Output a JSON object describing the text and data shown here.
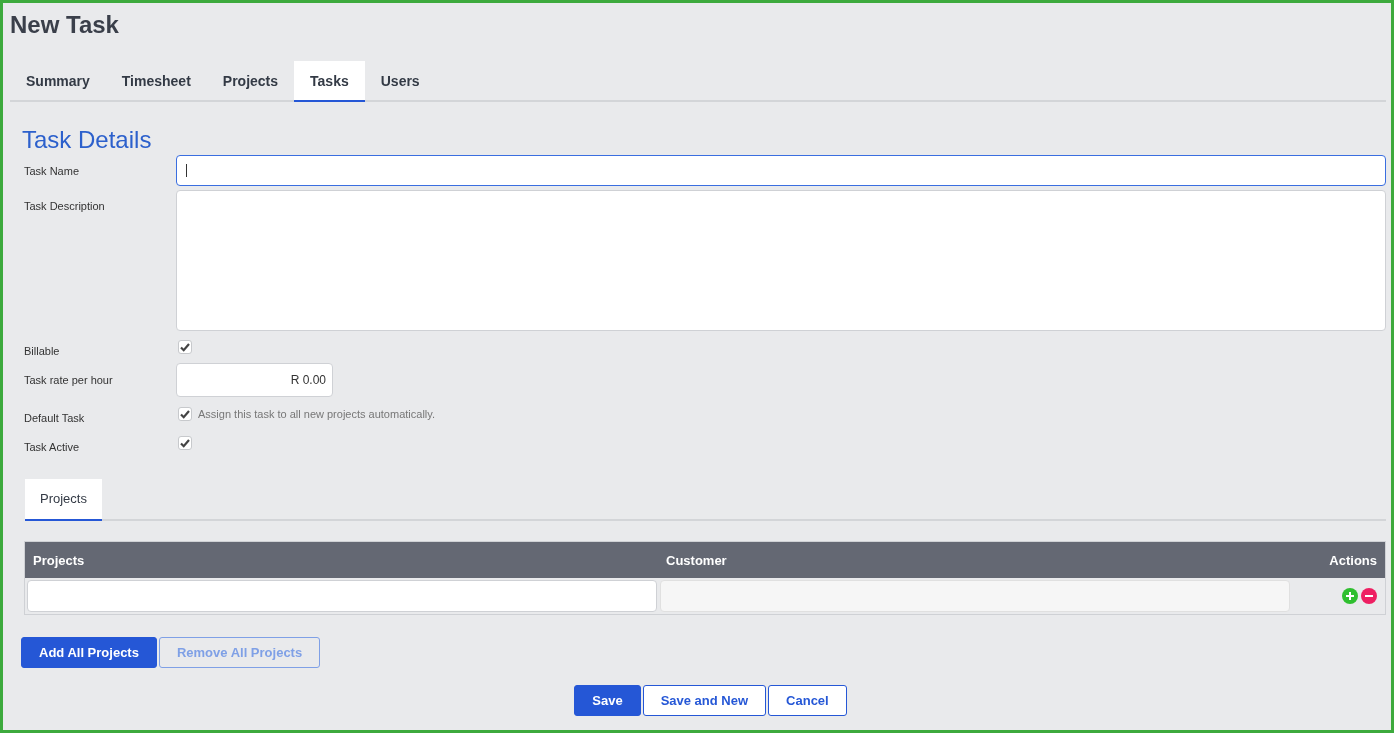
{
  "page_title": "New Task",
  "tabs": [
    {
      "label": "Summary",
      "selected": false
    },
    {
      "label": "Timesheet",
      "selected": false
    },
    {
      "label": "Projects",
      "selected": false
    },
    {
      "label": "Tasks",
      "selected": true
    },
    {
      "label": "Users",
      "selected": false
    }
  ],
  "section_title": "Task Details",
  "fields": [
    {
      "kind": "text",
      "label": "Task Name",
      "focused": true
    },
    {
      "kind": "textarea",
      "label": "Task Description"
    },
    {
      "kind": "checkbox",
      "label": "Billable",
      "checked": true
    },
    {
      "kind": "money",
      "label": "Task rate per hour",
      "value": "R 0.00"
    },
    {
      "kind": "checkbox",
      "label": "Default Task",
      "checked": true,
      "hint": "Assign this task to all new projects automatically."
    },
    {
      "kind": "checkbox",
      "label": "Task Active",
      "checked": true
    }
  ],
  "sub_tabs": [
    {
      "label": "Projects",
      "selected": true
    }
  ],
  "table": {
    "columns": [
      "Projects",
      "Customer",
      "Actions"
    ],
    "rows": [
      {
        "customer_disabled": true
      }
    ]
  },
  "table_buttons": [
    {
      "label": "Add All Projects",
      "primary": true,
      "disabled": false
    },
    {
      "label": "Remove All Projects",
      "primary": false,
      "disabled": true
    }
  ],
  "footer_buttons": [
    {
      "label": "Save",
      "primary": true,
      "disabled": false
    },
    {
      "label": "Save and New",
      "primary": false,
      "disabled": false
    },
    {
      "label": "Cancel",
      "primary": false,
      "disabled": false
    }
  ]
}
